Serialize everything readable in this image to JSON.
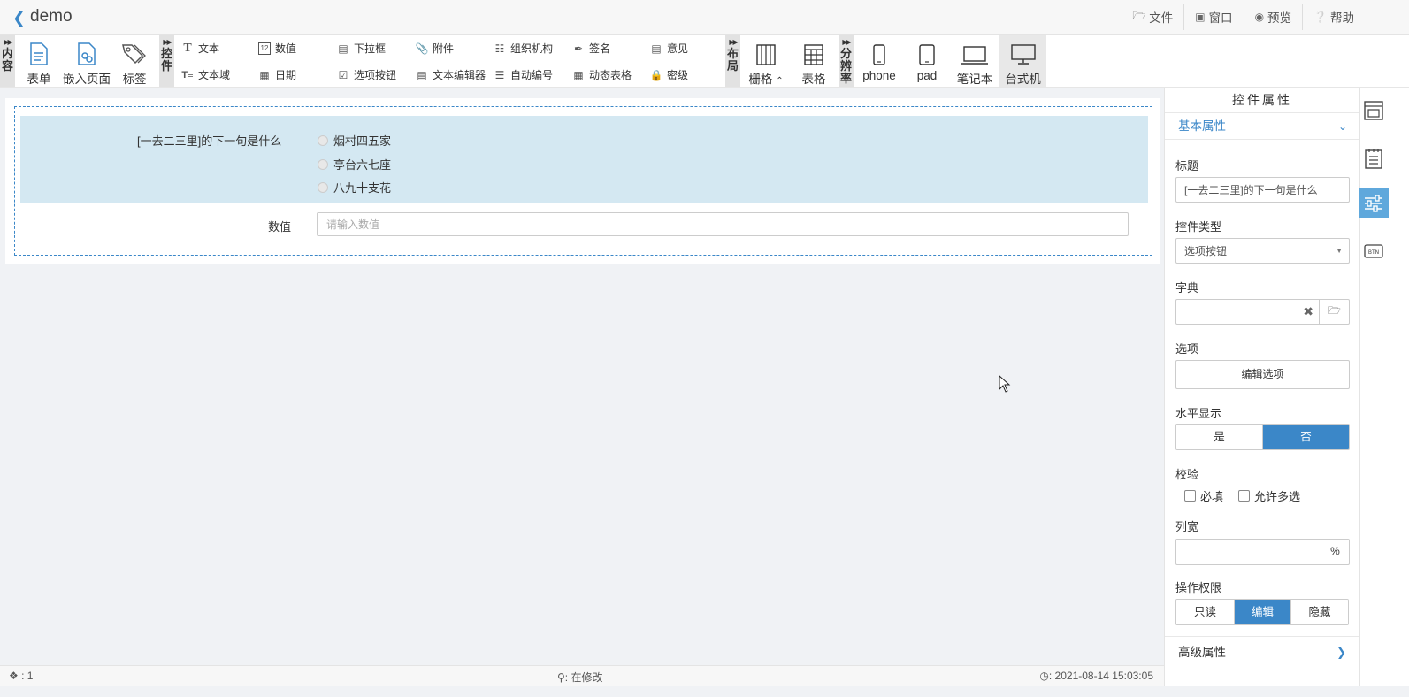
{
  "app": {
    "title": "demo"
  },
  "top_menu": [
    {
      "label": "文件",
      "icon": "folder-open-icon"
    },
    {
      "label": "窗口",
      "icon": "window-icon"
    },
    {
      "label": "预览",
      "icon": "eye-icon"
    },
    {
      "label": "帮助",
      "icon": "question-circle-icon"
    }
  ],
  "toolbar": {
    "content_group": "内容",
    "content_tools": [
      "表单",
      "嵌入页面",
      "标签"
    ],
    "control_group": "控件",
    "control_tools_row1": [
      "文本",
      "数值",
      "下拉框",
      "附件",
      "组织机构",
      "签名",
      "意见"
    ],
    "control_tools_row2": [
      "文本域",
      "日期",
      "选项按钮",
      "文本编辑器",
      "自动编号",
      "动态表格",
      "密级"
    ],
    "layout_group": "布局",
    "layout_tools": [
      "栅格",
      "表格"
    ],
    "resolution_group": "分辨率",
    "resolution_tools": [
      "phone",
      "pad",
      "笔记本",
      "台式机"
    ]
  },
  "form": {
    "question_label": "[一去二三里]的下一句是什么",
    "options": [
      "烟村四五家",
      "亭台六七座",
      "八九十支花"
    ],
    "number_label": "数值",
    "number_placeholder": "请输入数值"
  },
  "panel": {
    "title": "控件属性",
    "basic_section": "基本属性",
    "title_label": "标题",
    "title_value": "[一去二三里]的下一句是什么",
    "type_label": "控件类型",
    "type_value": "选项按钮",
    "dict_label": "字典",
    "dict_value": "",
    "options_label": "选项",
    "edit_options_button": "编辑选项",
    "horizontal_label": "水平显示",
    "horizontal_yes": "是",
    "horizontal_no": "否",
    "validate_label": "校验",
    "required_label": "必填",
    "multi_label": "允许多选",
    "width_label": "列宽",
    "width_value": "",
    "width_unit": "%",
    "perm_label": "操作权限",
    "perm_readonly": "只读",
    "perm_edit": "编辑",
    "perm_hide": "隐藏",
    "advanced_section": "高级属性"
  },
  "status": {
    "left": ": 1",
    "middle": ": 在修改",
    "right": ": 2021-08-14 15:03:05"
  },
  "colors": {
    "accent": "#3b87c8",
    "selected_row": "#d4e8f2",
    "strip_active": "#5fa8dc"
  }
}
